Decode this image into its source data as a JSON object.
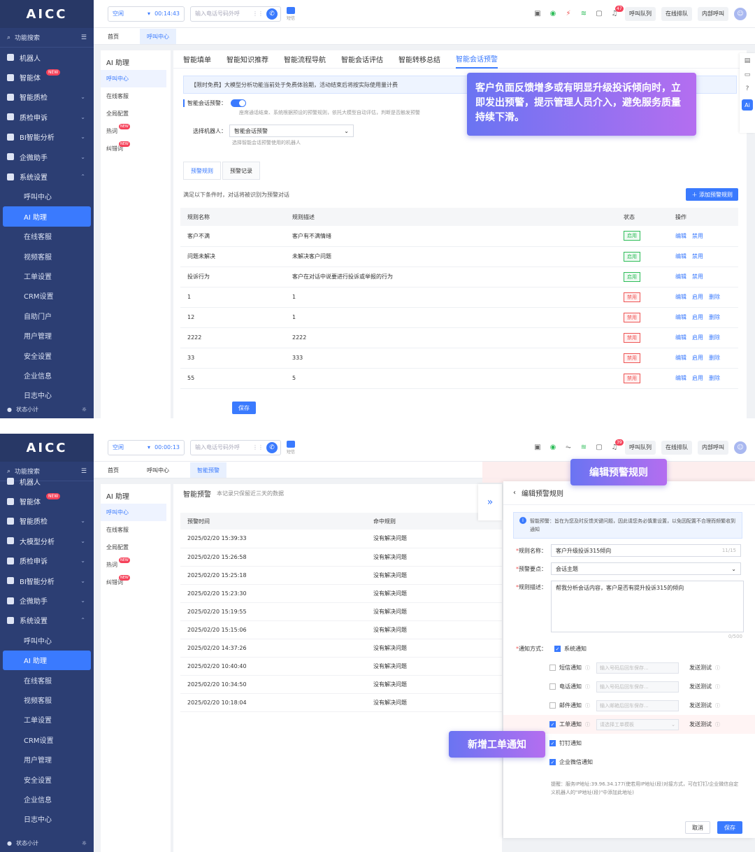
{
  "brand": "AICC",
  "colors": {
    "accent": "#3a7afe",
    "sidebar": "#2c3e73",
    "enabled": "#2ebd59",
    "disabled": "#e55555"
  },
  "topbar": {
    "status": "空闲",
    "shot1_timer": "00:14:43",
    "shot2_timer": "00:00:13",
    "dial_placeholder": "输入电话号码外呼",
    "sms_label": "短信",
    "shot1_bell_count": "47",
    "shot2_bell_count": "39",
    "queue_btn": "呼叫队列",
    "online_btn": "在线排队",
    "internal_btn": "内部呼叫"
  },
  "sidebar": {
    "search": "功能搜索",
    "footer": "状态小计",
    "new_badge": "NEW",
    "shot1_items": [
      {
        "label": "机器人",
        "icon": "robot-icon"
      },
      {
        "label": "智能体",
        "icon": "agent-icon",
        "new": true
      },
      {
        "label": "智能质检",
        "icon": "quality-icon",
        "chev": true
      },
      {
        "label": "质检申诉",
        "icon": "shield-icon",
        "chev": true
      },
      {
        "label": "BI智能分析",
        "icon": "chart-icon",
        "chev": true
      },
      {
        "label": "企微助手",
        "icon": "chat-icon",
        "chev": true
      },
      {
        "label": "系统设置",
        "icon": "grid-icon",
        "expanded": true
      }
    ],
    "shot1_subitems": [
      "呼叫中心",
      "AI 助理",
      "在线客服",
      "视频客服",
      "工单设置",
      "CRM设置",
      "自助门户",
      "用户管理",
      "安全设置",
      "企业信息",
      "日志中心"
    ],
    "shot2_items": [
      {
        "label": "机器人",
        "icon": "robot-icon"
      },
      {
        "label": "智能体",
        "icon": "agent-icon",
        "new": true
      },
      {
        "label": "智能质检",
        "icon": "quality-icon",
        "chev": true
      },
      {
        "label": "大模型分析",
        "icon": "model-icon",
        "chev": true
      },
      {
        "label": "质检申诉",
        "icon": "shield-icon",
        "chev": true
      },
      {
        "label": "BI智能分析",
        "icon": "chart-icon",
        "chev": true
      },
      {
        "label": "企微助手",
        "icon": "chat-icon",
        "chev": true
      },
      {
        "label": "系统设置",
        "icon": "grid-icon",
        "expanded": true
      }
    ],
    "shot2_subitems": [
      "呼叫中心",
      "AI 助理",
      "在线客服",
      "视频客服",
      "工单设置",
      "CRM设置",
      "用户管理",
      "安全设置",
      "企业信息",
      "日志中心"
    ],
    "active_sub": "AI 助理"
  },
  "page_tabs": {
    "shot1": [
      "首页",
      "呼叫中心"
    ],
    "shot2": [
      "首页",
      "呼叫中心",
      "智能预警"
    ]
  },
  "subnav": {
    "head": "AI 助理",
    "items": [
      "呼叫中心",
      "在线客服",
      "全局配置",
      "热词",
      "纠错词"
    ],
    "new_on": [
      "热词",
      "纠错词"
    ]
  },
  "shot1": {
    "tabs": [
      "智能填单",
      "智能知识推荐",
      "智能流程导航",
      "智能会话评估",
      "智能转移总结",
      "智能会话预警"
    ],
    "active_tab": "智能会话预警",
    "notice": "【限时免费】大模型分析功能当前处于免费体验期，活动结束后将按实际使用量计费",
    "toggle_label": "智能会话预警：",
    "toggle_hint": "座席通话结束、系统根据预设的预警规则，依托大模型自动评估，判断是否触发预警",
    "select_label": "选择机器人：",
    "select_value": "智能会话预警",
    "select_hint": "选择智能会话预警使用的机器人",
    "inner_tabs": [
      "预警规则",
      "预警记录"
    ],
    "condition": "满足以下条件时，对话将被识别为预警对话",
    "add_btn": "＋ 添加预警规则",
    "columns": [
      "规则名称",
      "规则描述",
      "状态",
      "操作"
    ],
    "status_on": "启用",
    "status_off": "禁用",
    "op_edit": "编辑",
    "op_enable": "启用",
    "op_disable": "禁用",
    "op_delete": "删除",
    "rows": [
      {
        "name": "客户不满",
        "desc": "客户有不满情绪",
        "enabled": true
      },
      {
        "name": "问题未解决",
        "desc": "未解决客户问题",
        "enabled": true
      },
      {
        "name": "投诉行为",
        "desc": "客户在对话中说要进行投诉或举报的行为",
        "enabled": true
      },
      {
        "name": "1",
        "desc": "1",
        "enabled": false
      },
      {
        "name": "12",
        "desc": "1",
        "enabled": false
      },
      {
        "name": "2222",
        "desc": "2222",
        "enabled": false
      },
      {
        "name": "33",
        "desc": "333",
        "enabled": false
      },
      {
        "name": "55",
        "desc": "5",
        "enabled": false
      }
    ],
    "save": "保存",
    "callout": "客户负面反馈增多或有明显升级投诉倾向时，立即发出预警，提示管理人员介入，避免服务质量持续下滑。"
  },
  "shot2": {
    "title": "智能预警",
    "subtitle": "本记录只保留近三天的数据",
    "columns": [
      "预警时间",
      "命中规则"
    ],
    "rows": [
      {
        "time": "2025/02/20 15:39:33",
        "rule": "没有解决问题"
      },
      {
        "time": "2025/02/20 15:26:58",
        "rule": "没有解决问题"
      },
      {
        "time": "2025/02/20 15:25:18",
        "rule": "没有解决问题"
      },
      {
        "time": "2025/02/20 15:23:30",
        "rule": "没有解决问题"
      },
      {
        "time": "2025/02/20 15:19:55",
        "rule": "没有解决问题"
      },
      {
        "time": "2025/02/20 15:15:06",
        "rule": "没有解决问题"
      },
      {
        "time": "2025/02/20 14:37:26",
        "rule": "没有解决问题"
      },
      {
        "time": "2025/02/20 10:40:40",
        "rule": "没有解决问题"
      },
      {
        "time": "2025/02/20 10:34:50",
        "rule": "没有解决问题"
      },
      {
        "time": "2025/02/20 10:18:04",
        "rule": "没有解决问题"
      }
    ],
    "drawer_title": "编辑预警规则",
    "info": "智能预警：旨在为您及时反馈关键问题，因此请您务必慎重设置，以免因配置不合理而频繁收到通知",
    "name_label": "规则名称：",
    "name_value": "客户升级投诉315倾向",
    "name_count": "11/15",
    "point_label": "预警要点：",
    "point_value": "会话主题",
    "desc_label": "规则描述：",
    "desc_value": "帮我分析会话内容，客户是否有提升投诉315的倾向",
    "desc_count": "0/500",
    "notify_label": "通知方式：",
    "notify": [
      {
        "label": "系统通知",
        "checked": true
      },
      {
        "label": "短信通知",
        "checked": false,
        "input": "输入号码后回车保存...",
        "test": "发送测试"
      },
      {
        "label": "电话通知",
        "checked": false,
        "input": "输入号码后回车保存...",
        "test": "发送测试"
      },
      {
        "label": "邮件通知",
        "checked": false,
        "input": "输入邮箱后回车保存...",
        "test": "发送测试"
      },
      {
        "label": "工单通知",
        "checked": true,
        "input": "请选择工单模板",
        "test": "发送测试"
      },
      {
        "label": "钉钉通知",
        "checked": true
      },
      {
        "label": "企业微信通知",
        "checked": true
      }
    ],
    "tip": "提醒：服务IP地址:39.96.34.177(使若用IP地址(段)对接方式，可在钉钉/企业微信自定义机器人的\"IP地址(段)\"中添加此地址)",
    "cancel": "取消",
    "save": "保存",
    "callout_edit": "编辑预警规则",
    "callout_ticket": "新增工单通知"
  }
}
